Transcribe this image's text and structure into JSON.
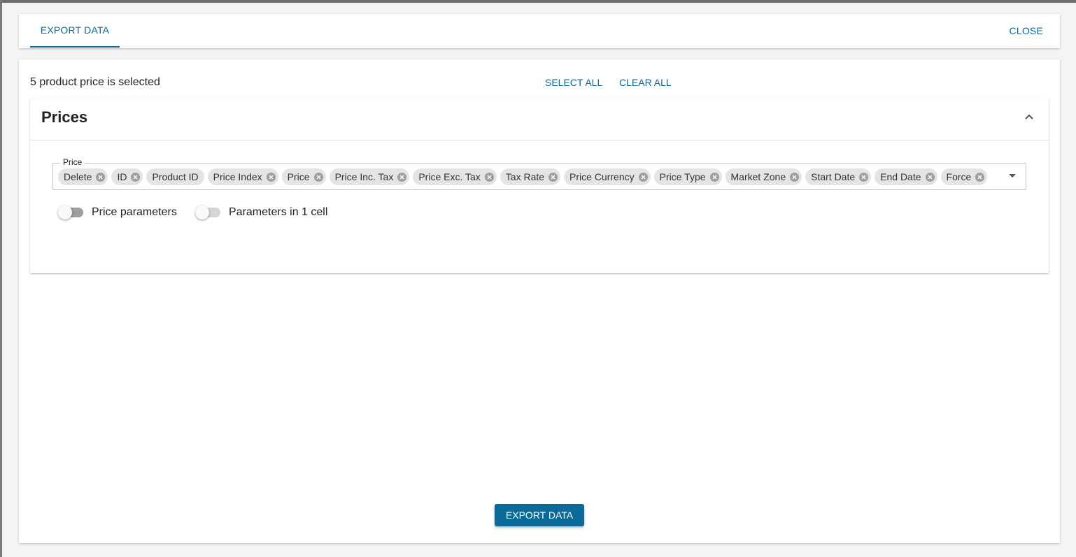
{
  "header": {
    "tab_label": "EXPORT DATA",
    "close_label": "CLOSE"
  },
  "toolbar": {
    "selected_text": "5 product price is selected",
    "select_all_label": "SELECT ALL",
    "clear_all_label": "CLEAR ALL"
  },
  "section": {
    "title": "Prices",
    "field_label": "Price",
    "chips": [
      {
        "label": "Delete",
        "removable": true
      },
      {
        "label": "ID",
        "removable": true
      },
      {
        "label": "Product ID",
        "removable": false
      },
      {
        "label": "Price Index",
        "removable": true
      },
      {
        "label": "Price",
        "removable": true
      },
      {
        "label": "Price Inc. Tax",
        "removable": true
      },
      {
        "label": "Price Exc. Tax",
        "removable": true
      },
      {
        "label": "Tax Rate",
        "removable": true
      },
      {
        "label": "Price Currency",
        "removable": true
      },
      {
        "label": "Price Type",
        "removable": true
      },
      {
        "label": "Market Zone",
        "removable": true
      },
      {
        "label": "Start Date",
        "removable": true
      },
      {
        "label": "End Date",
        "removable": true
      },
      {
        "label": "Force",
        "removable": true
      }
    ],
    "toggles": [
      {
        "label": "Price parameters",
        "on": false,
        "track_color": "#9e9e9e"
      },
      {
        "label": "Parameters in 1 cell",
        "on": false,
        "track_color": "#d6d6d6"
      }
    ]
  },
  "footer": {
    "export_label": "EXPORT DATA"
  },
  "colors": {
    "accent": "#0a6a99"
  }
}
